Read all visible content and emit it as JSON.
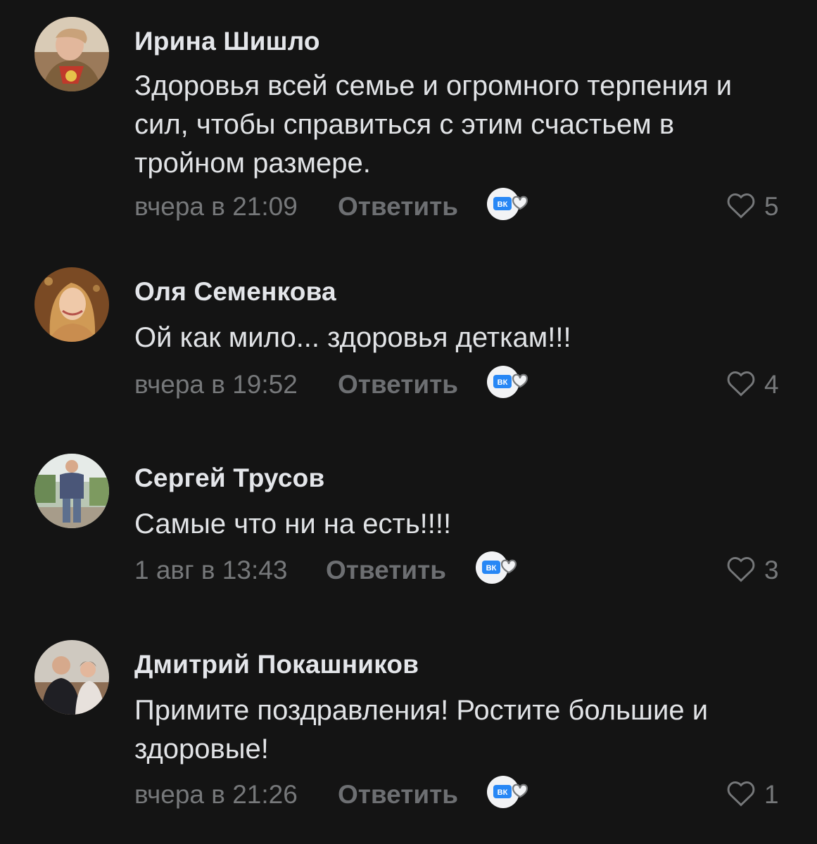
{
  "comments": [
    {
      "author": "Ирина Шишло",
      "text": "Здоровья всей семье и огромного терпения и сил, чтобы справиться с этим счастьем в тройном размере.",
      "time": "вчера в 21:09",
      "reply_label": "Ответить",
      "likes": "5",
      "avatar": "avatar-photo-woman-red-scarf"
    },
    {
      "author": "Оля Семенкова",
      "text": "Ой как мило... здоровья деткам!!!",
      "time": "вчера в 19:52",
      "reply_label": "Ответить",
      "likes": "4",
      "avatar": "avatar-photo-woman-blonde"
    },
    {
      "author": "Сергей Трусов",
      "text": "Самые что ни на есть!!!!",
      "time": "1 авг в 13:43",
      "reply_label": "Ответить",
      "likes": "3",
      "avatar": "avatar-photo-man-outdoors"
    },
    {
      "author": "Дмитрий Покашников",
      "text": "Примите поздравления! Ростите большие  и здоровые!",
      "time": "вчера в 21:26",
      "reply_label": "Ответить",
      "likes": "1",
      "avatar": "avatar-photo-two-people"
    }
  ],
  "icons": {
    "reaction": "vk-reaction-icon",
    "like": "heart-outline-icon"
  },
  "colors": {
    "background": "#141414",
    "author": "#e4e6ea",
    "text": "#e1e3e6",
    "meta": "#76787a",
    "vk_blue": "#2787f5"
  }
}
